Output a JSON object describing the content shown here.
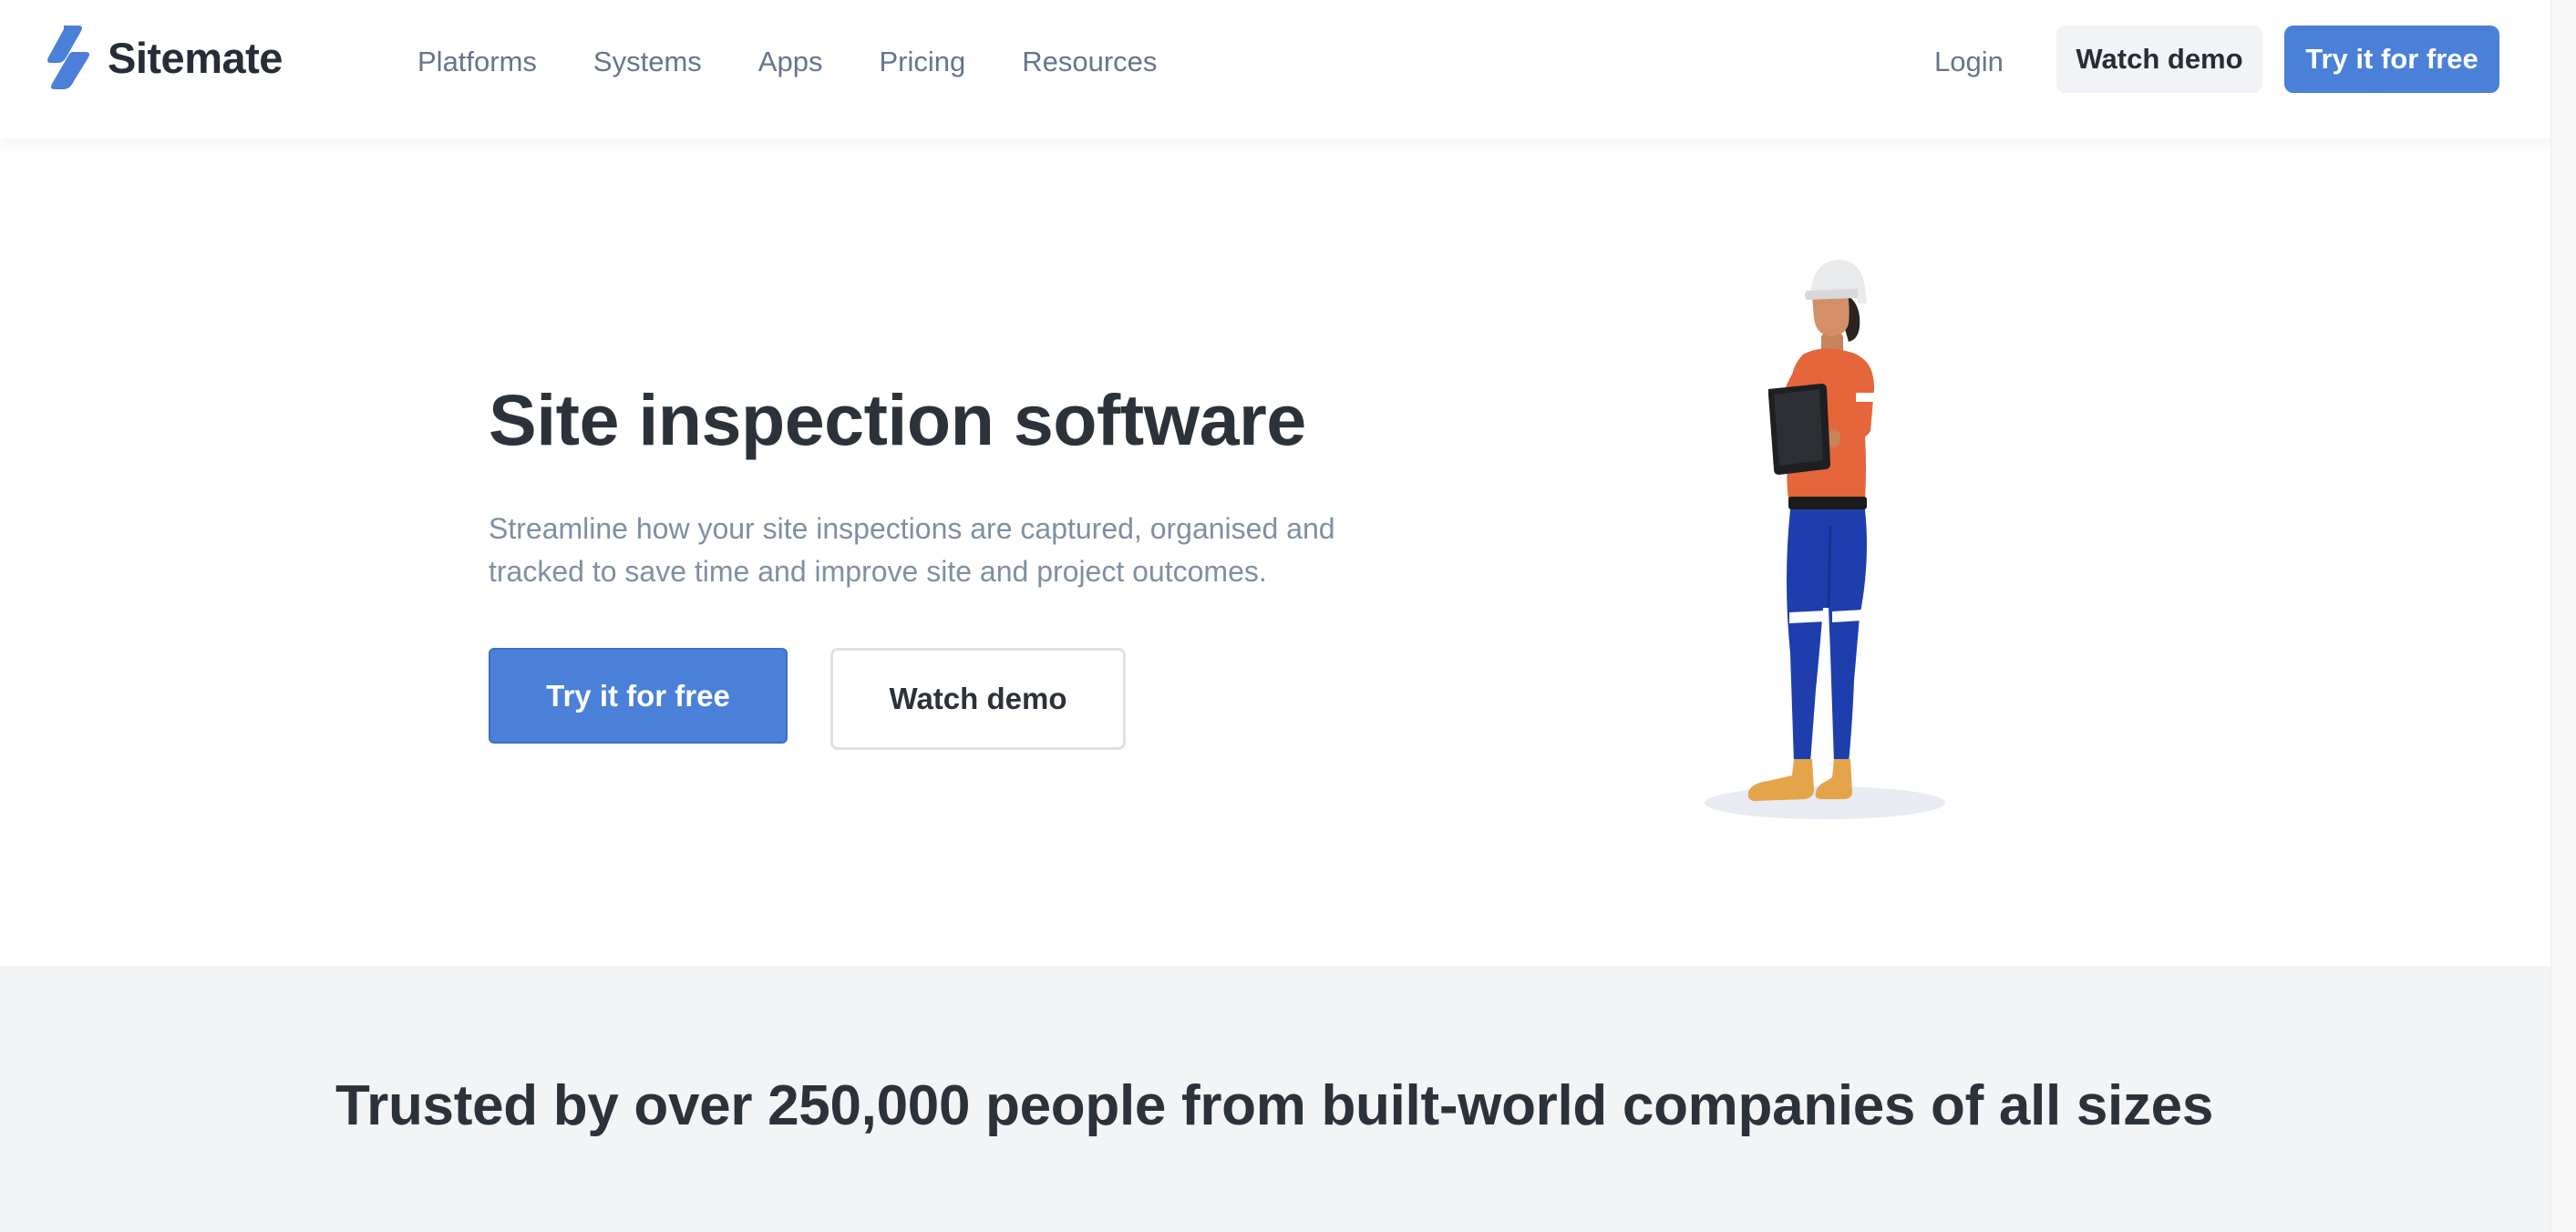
{
  "brand": {
    "name": "Sitemate",
    "accent_color": "#4a80d8"
  },
  "nav": {
    "items": [
      {
        "label": "Platforms"
      },
      {
        "label": "Systems"
      },
      {
        "label": "Apps"
      },
      {
        "label": "Pricing"
      },
      {
        "label": "Resources"
      }
    ],
    "login_label": "Login",
    "demo_label": "Watch demo",
    "try_label": "Try it for free"
  },
  "hero": {
    "title": "Site inspection software",
    "subtitle": "Streamline how your site inspections are captured, organised and tracked to save time and improve site and project outcomes.",
    "primary_cta": "Try it for free",
    "secondary_cta": "Watch demo",
    "illustration": "construction-worker-with-tablet"
  },
  "trusted": {
    "title": "Trusted by over 250,000 people from built-world companies of all sizes"
  }
}
